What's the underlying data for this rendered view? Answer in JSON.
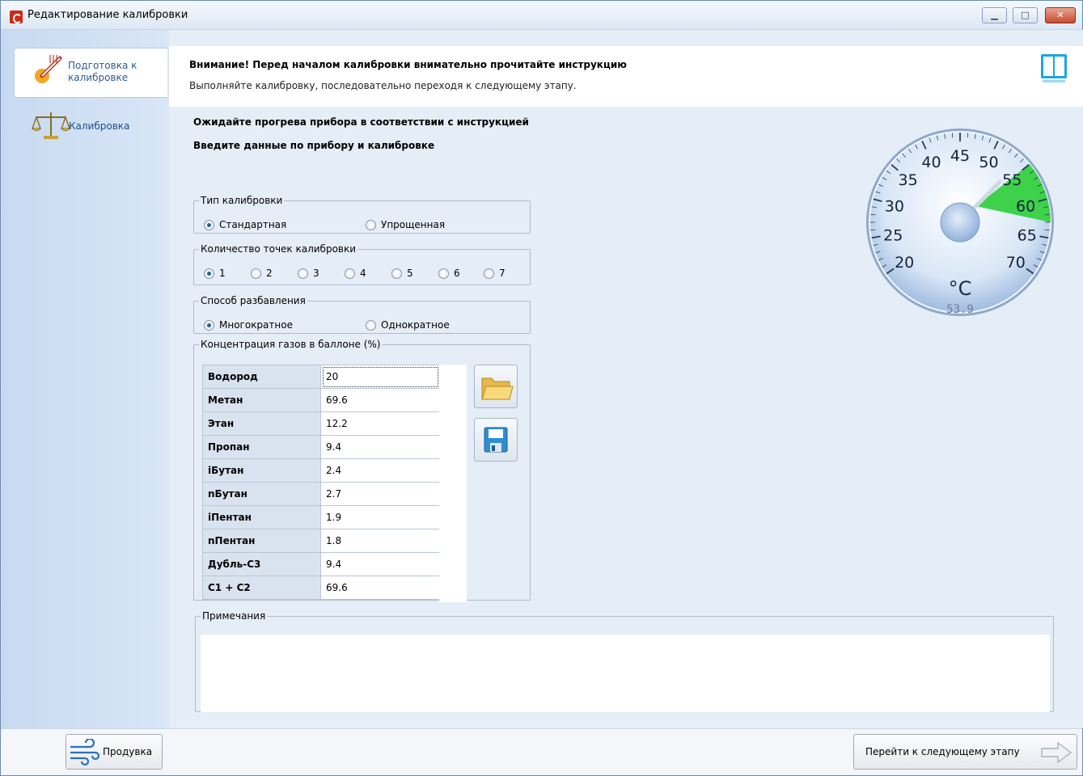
{
  "window": {
    "title": "Редактирование калибровки",
    "controls": {
      "minimize": "▁",
      "maximize": "□",
      "close": "✕"
    }
  },
  "sidebar": {
    "items": [
      {
        "label_line1": "Подготовка к",
        "label_line2": "калибровке",
        "icon": "thermometer-icon",
        "selected": true
      },
      {
        "label_line1": "Калибровка",
        "label_line2": "",
        "icon": "scales-icon",
        "selected": false
      }
    ]
  },
  "header": {
    "warning": "Внимание! Перед началом калибровки внимательно прочитайте инструкцию",
    "subtitle": "Выполняйте калибровку, последовательно переходя к следующему этапу.",
    "icon": "book-icon"
  },
  "instructions": {
    "line1": "Ожидайте прогрева прибора в соответствии с инструкцией",
    "line2": "Введите данные по прибору и калибровке"
  },
  "calibration_type": {
    "legend": "Тип калибровки",
    "options": [
      {
        "label": "Стандартная",
        "checked": true
      },
      {
        "label": "Упрощенная",
        "checked": false
      }
    ]
  },
  "points": {
    "legend": "Количество точек калибровки",
    "options": [
      {
        "label": "1",
        "checked": true
      },
      {
        "label": "2",
        "checked": false
      },
      {
        "label": "3",
        "checked": false
      },
      {
        "label": "4",
        "checked": false
      },
      {
        "label": "5",
        "checked": false
      },
      {
        "label": "6",
        "checked": false
      },
      {
        "label": "7",
        "checked": false
      }
    ]
  },
  "dilution": {
    "legend": "Способ разбавления",
    "options": [
      {
        "label": "Многократное",
        "checked": true
      },
      {
        "label": "Однократное",
        "checked": false
      }
    ]
  },
  "gases": {
    "legend": "Концентрация газов в баллоне (%)",
    "rows": [
      {
        "name": "Водород",
        "value": "20"
      },
      {
        "name": "Метан",
        "value": "69.6"
      },
      {
        "name": "Этан",
        "value": "12.2"
      },
      {
        "name": "Пропан",
        "value": "9.4"
      },
      {
        "name": "iБутан",
        "value": "2.4"
      },
      {
        "name": "nБутан",
        "value": "2.7"
      },
      {
        "name": "iПентан",
        "value": "1.9"
      },
      {
        "name": "nПентан",
        "value": "1.8"
      },
      {
        "name": "Дубль-С3",
        "value": "9.4"
      },
      {
        "name": "С1 + С2",
        "value": "69.6"
      }
    ],
    "open_icon": "folder-open-icon",
    "save_icon": "floppy-save-icon"
  },
  "notes": {
    "legend": "Примечания",
    "value": ""
  },
  "gauge": {
    "unit": "°C",
    "ticks": [
      "20",
      "25",
      "30",
      "35",
      "40",
      "45",
      "50",
      "55",
      "60",
      "65",
      "70"
    ],
    "min": 20,
    "max": 70,
    "value": 53.9,
    "value_text": "53.9",
    "zone_min": 55,
    "zone_max": 63,
    "zone_color": "#3dd24a"
  },
  "footer": {
    "purge_label": "Продувка",
    "purge_icon": "wind-icon",
    "next_label": "Перейти к следующему этапу",
    "next_icon": "arrow-right-icon"
  },
  "colors": {
    "accent": "#1f4f86",
    "sidebar": "#c8daf1",
    "panel": "#e5edf7",
    "book": "#1aa6e8",
    "close": "#c74a33"
  }
}
